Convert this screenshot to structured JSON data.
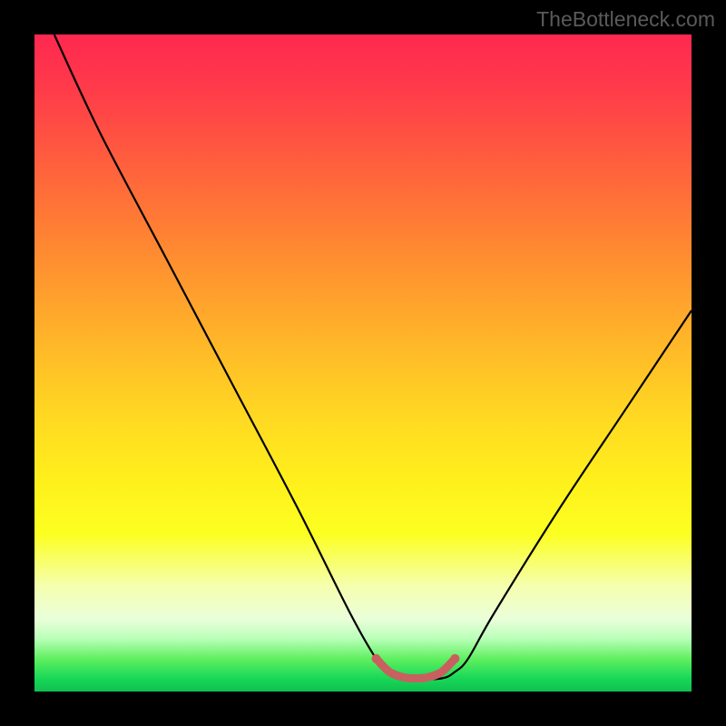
{
  "watermark": "TheBottleneck.com",
  "chart_data": {
    "type": "line",
    "title": "",
    "xlabel": "",
    "ylabel": "",
    "xlim": [
      0,
      100
    ],
    "ylim": [
      0,
      100
    ],
    "series": [
      {
        "name": "bottleneck-curve",
        "x": [
          3,
          10,
          20,
          30,
          40,
          48,
          52,
          54,
          58,
          62,
          64,
          66,
          70,
          80,
          90,
          100
        ],
        "y": [
          100,
          85,
          66,
          47,
          28,
          12,
          5,
          3,
          2,
          2,
          3,
          5,
          12,
          28,
          43,
          58
        ],
        "color": "#000000"
      },
      {
        "name": "highlight-segment",
        "x": [
          52,
          54,
          56,
          58,
          60,
          62,
          64
        ],
        "y": [
          5,
          3,
          2.2,
          2,
          2.2,
          3,
          5
        ],
        "color": "#c86060"
      }
    ],
    "gradient_bands": [
      {
        "position": 0,
        "color": "#ff2850"
      },
      {
        "position": 50,
        "color": "#ffd020"
      },
      {
        "position": 85,
        "color": "#f5ffb0"
      },
      {
        "position": 95,
        "color": "#60f060"
      },
      {
        "position": 100,
        "color": "#10c050"
      }
    ]
  }
}
